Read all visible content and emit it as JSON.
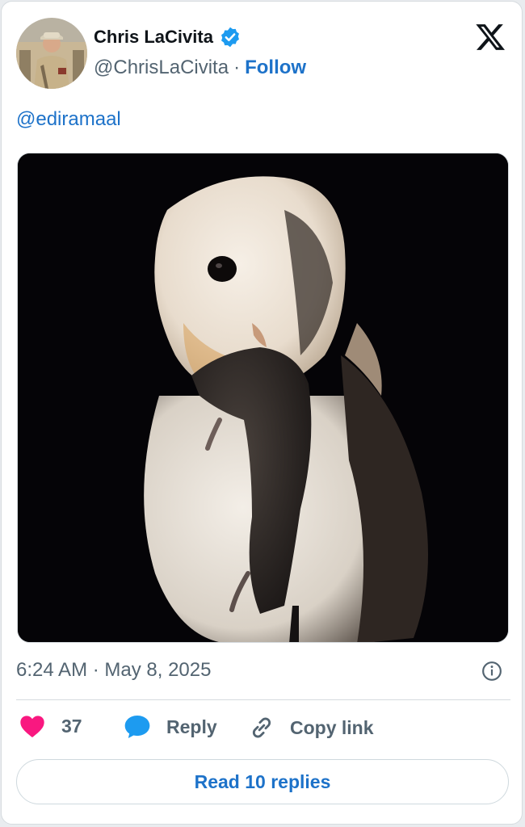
{
  "tweet": {
    "author": {
      "name": "Chris LaCivita",
      "handle": "@ChrisLaCivita",
      "verified_icon": "verified-badge-icon",
      "follow_label": "Follow",
      "separator": "·"
    },
    "platform_icon": "x-logo-icon",
    "text": "@ediramaal",
    "media": {
      "icon": "owl-photo"
    },
    "timestamp": "6:24 AM · May 8, 2025",
    "info_icon": "info-icon",
    "actions": {
      "likes": {
        "icon": "heart-icon",
        "count": "37",
        "color": "#f91880"
      },
      "reply": {
        "icon": "speech-bubble-icon",
        "label": "Reply",
        "color": "#1d9bf0"
      },
      "copy_link": {
        "icon": "link-icon",
        "label": "Copy link"
      }
    },
    "read_replies_label": "Read 10 replies",
    "accent_color": "#1d72c9"
  }
}
